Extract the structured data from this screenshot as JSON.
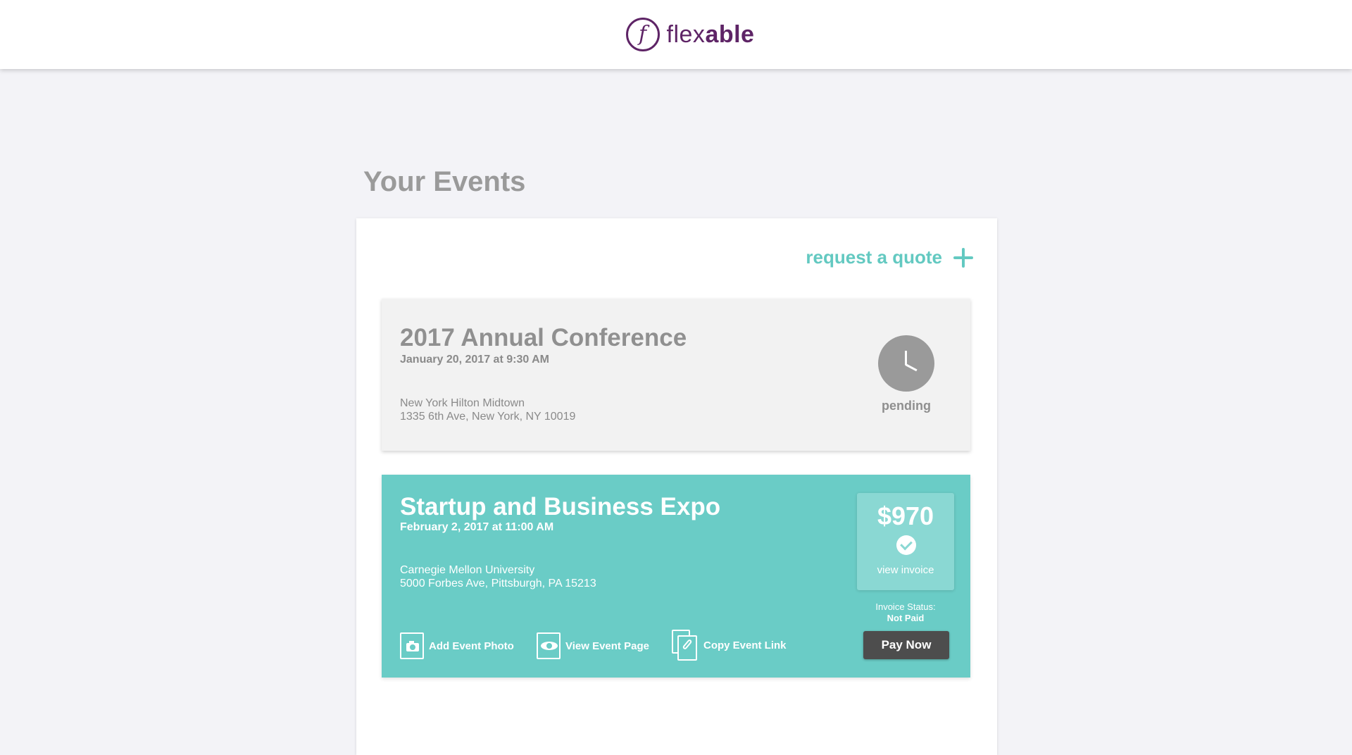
{
  "header": {
    "logo_mark": "f",
    "logo_light": "flex",
    "logo_bold": "able",
    "brand_color": "#5e2466"
  },
  "page": {
    "title": "Your Events"
  },
  "actions": {
    "request_quote": "request a quote"
  },
  "events": [
    {
      "title": "2017 Annual Conference",
      "datetime": "January 20, 2017 at 9:30 AM",
      "venue": "New York Hilton Midtown",
      "address": "1335 6th Ave, New York, NY 10019",
      "status": "pending",
      "status_icon": "clock-icon"
    },
    {
      "title": "Startup and Business Expo",
      "datetime": "February 2, 2017 at 11:00 AM",
      "venue": "Carnegie Mellon University",
      "address": "5000 Forbes Ave, Pittsburgh, PA 15213",
      "amount": "$970",
      "invoice_icon": "check-circle-icon",
      "invoice_link": "view invoice",
      "invoice_status_label": "Invoice Status:",
      "invoice_status": "Not Paid",
      "pay_label": "Pay Now",
      "links": {
        "add_photo": "Add Event Photo",
        "view_page": "View Event Page",
        "copy_link": "Copy Event Link"
      },
      "accent_color": "#6accc6"
    }
  ],
  "colors": {
    "accent": "#63c9c1",
    "background": "#f3f3f7",
    "pay_button": "#4d4d4d"
  }
}
